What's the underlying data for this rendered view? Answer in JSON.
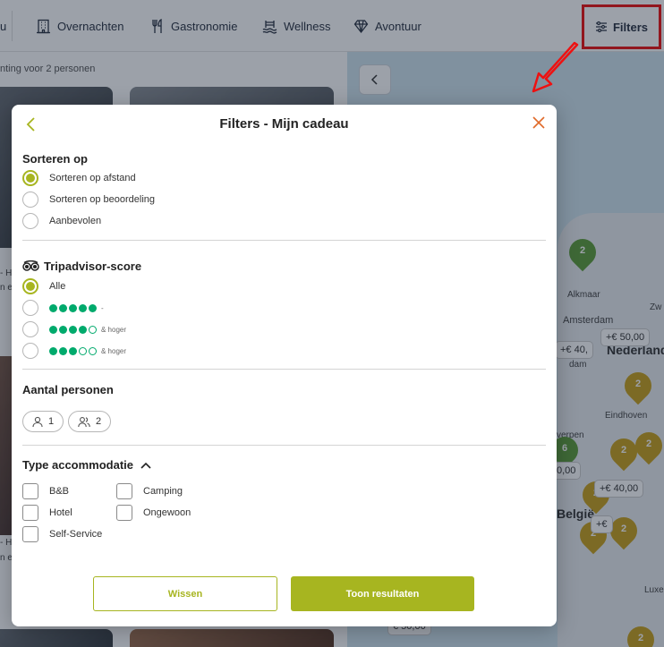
{
  "nav": {
    "first_fragment": "u",
    "items": [
      "Overnachten",
      "Gastronomie",
      "Wellness",
      "Avontuur"
    ],
    "filters_label": "Filters"
  },
  "page": {
    "subtitle": "nting voor 2 personen",
    "fragments": [
      "- Ho",
      "n e",
      "- Ho",
      "n e"
    ]
  },
  "map": {
    "labels": [
      "Alkmaar",
      "Amsterdam",
      "Nederland",
      "dam",
      "Eindhoven",
      "verpen",
      "België",
      "Luxe",
      "Zw"
    ],
    "prices": [
      "+€ 50,00",
      "+€ 40,",
      "+€ 40,00",
      "+€",
      "0,00",
      "€ 50,00"
    ],
    "pins": [
      "2",
      "2",
      "2",
      "2",
      "2",
      "2",
      "6",
      "2",
      "2"
    ]
  },
  "modal": {
    "title": "Filters - Mijn cadeau",
    "sort": {
      "title": "Sorteren op",
      "options": [
        {
          "label": "Sorteren op afstand",
          "checked": true
        },
        {
          "label": "Sorteren op beoordeling",
          "checked": false
        },
        {
          "label": "Aanbevolen",
          "checked": false
        }
      ]
    },
    "tripadvisor": {
      "title": "Tripadvisor-score",
      "all_label": "Alle",
      "rows": [
        {
          "filled": 5,
          "suffix": "-"
        },
        {
          "filled": 4,
          "suffix": "& hoger"
        },
        {
          "filled": 3,
          "suffix": "& hoger"
        }
      ]
    },
    "persons": {
      "title": "Aantal personen",
      "chips": [
        "1",
        "2"
      ]
    },
    "accommodation": {
      "title": "Type accommodatie",
      "options": [
        "B&B",
        "Camping",
        "Hotel",
        "Ongewoon",
        "Self-Service"
      ]
    },
    "buttons": {
      "clear": "Wissen",
      "apply": "Toon resultaten"
    }
  },
  "colors": {
    "accent": "#a7b520",
    "tripadvisor_green": "#00aa6c",
    "highlight_red": "#ee1111"
  }
}
